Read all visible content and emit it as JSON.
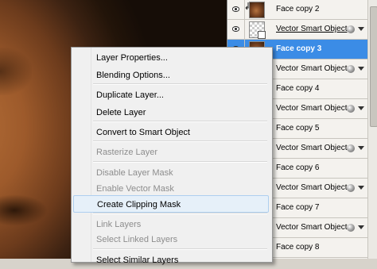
{
  "layers_panel": {
    "layers": [
      {
        "name": "Face copy 2",
        "kind": "image",
        "clipped": true
      },
      {
        "name": "Vector Smart Object",
        "kind": "smart-object",
        "underlined": true
      },
      {
        "name": "Face copy 3",
        "kind": "image",
        "selected": true
      },
      {
        "name": "Vector Smart Object",
        "kind": "smart-object"
      },
      {
        "name": "Face copy 4",
        "kind": "image"
      },
      {
        "name": "Vector Smart Object",
        "kind": "smart-object"
      },
      {
        "name": "Face copy 5",
        "kind": "image"
      },
      {
        "name": "Vector Smart Object",
        "kind": "smart-object"
      },
      {
        "name": "Face copy 6",
        "kind": "image"
      },
      {
        "name": "Vector Smart Object",
        "kind": "smart-object"
      },
      {
        "name": "Face copy 7",
        "kind": "image"
      },
      {
        "name": "Vector Smart Object",
        "kind": "smart-object"
      },
      {
        "name": "Face copy 8",
        "kind": "image"
      }
    ]
  },
  "context_menu": {
    "items": [
      {
        "label": "Layer Properties...",
        "enabled": true
      },
      {
        "label": "Blending Options...",
        "enabled": true
      },
      {
        "label": "Duplicate Layer...",
        "enabled": true
      },
      {
        "label": "Delete Layer",
        "enabled": true
      },
      {
        "label": "Convert to Smart Object",
        "enabled": true
      },
      {
        "label": "Rasterize Layer",
        "enabled": false
      },
      {
        "label": "Disable Layer Mask",
        "enabled": false
      },
      {
        "label": "Enable Vector Mask",
        "enabled": false
      },
      {
        "label": "Create Clipping Mask",
        "enabled": true,
        "highlighted": true
      },
      {
        "label": "Link Layers",
        "enabled": false
      },
      {
        "label": "Select Linked Layers",
        "enabled": false
      },
      {
        "label": "Select Similar Layers",
        "enabled": true
      }
    ]
  },
  "colors": {
    "selection": "#3b8ce6",
    "menu_hover": "#e6f0f9",
    "backdrop": "#5f8fbf"
  }
}
